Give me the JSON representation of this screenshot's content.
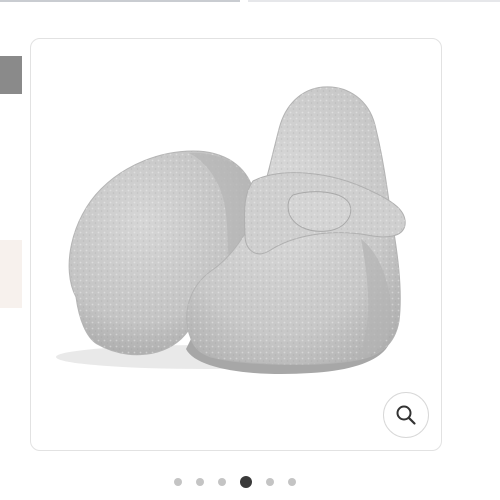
{
  "gallery": {
    "active_index": 3,
    "slide_count": 6
  },
  "colors": {
    "active_dot": "#3a3a3a",
    "inactive_dot": "#c4c4c4",
    "product_color": "#c9c9c9"
  },
  "icons": {
    "zoom": "magnifier-icon"
  }
}
